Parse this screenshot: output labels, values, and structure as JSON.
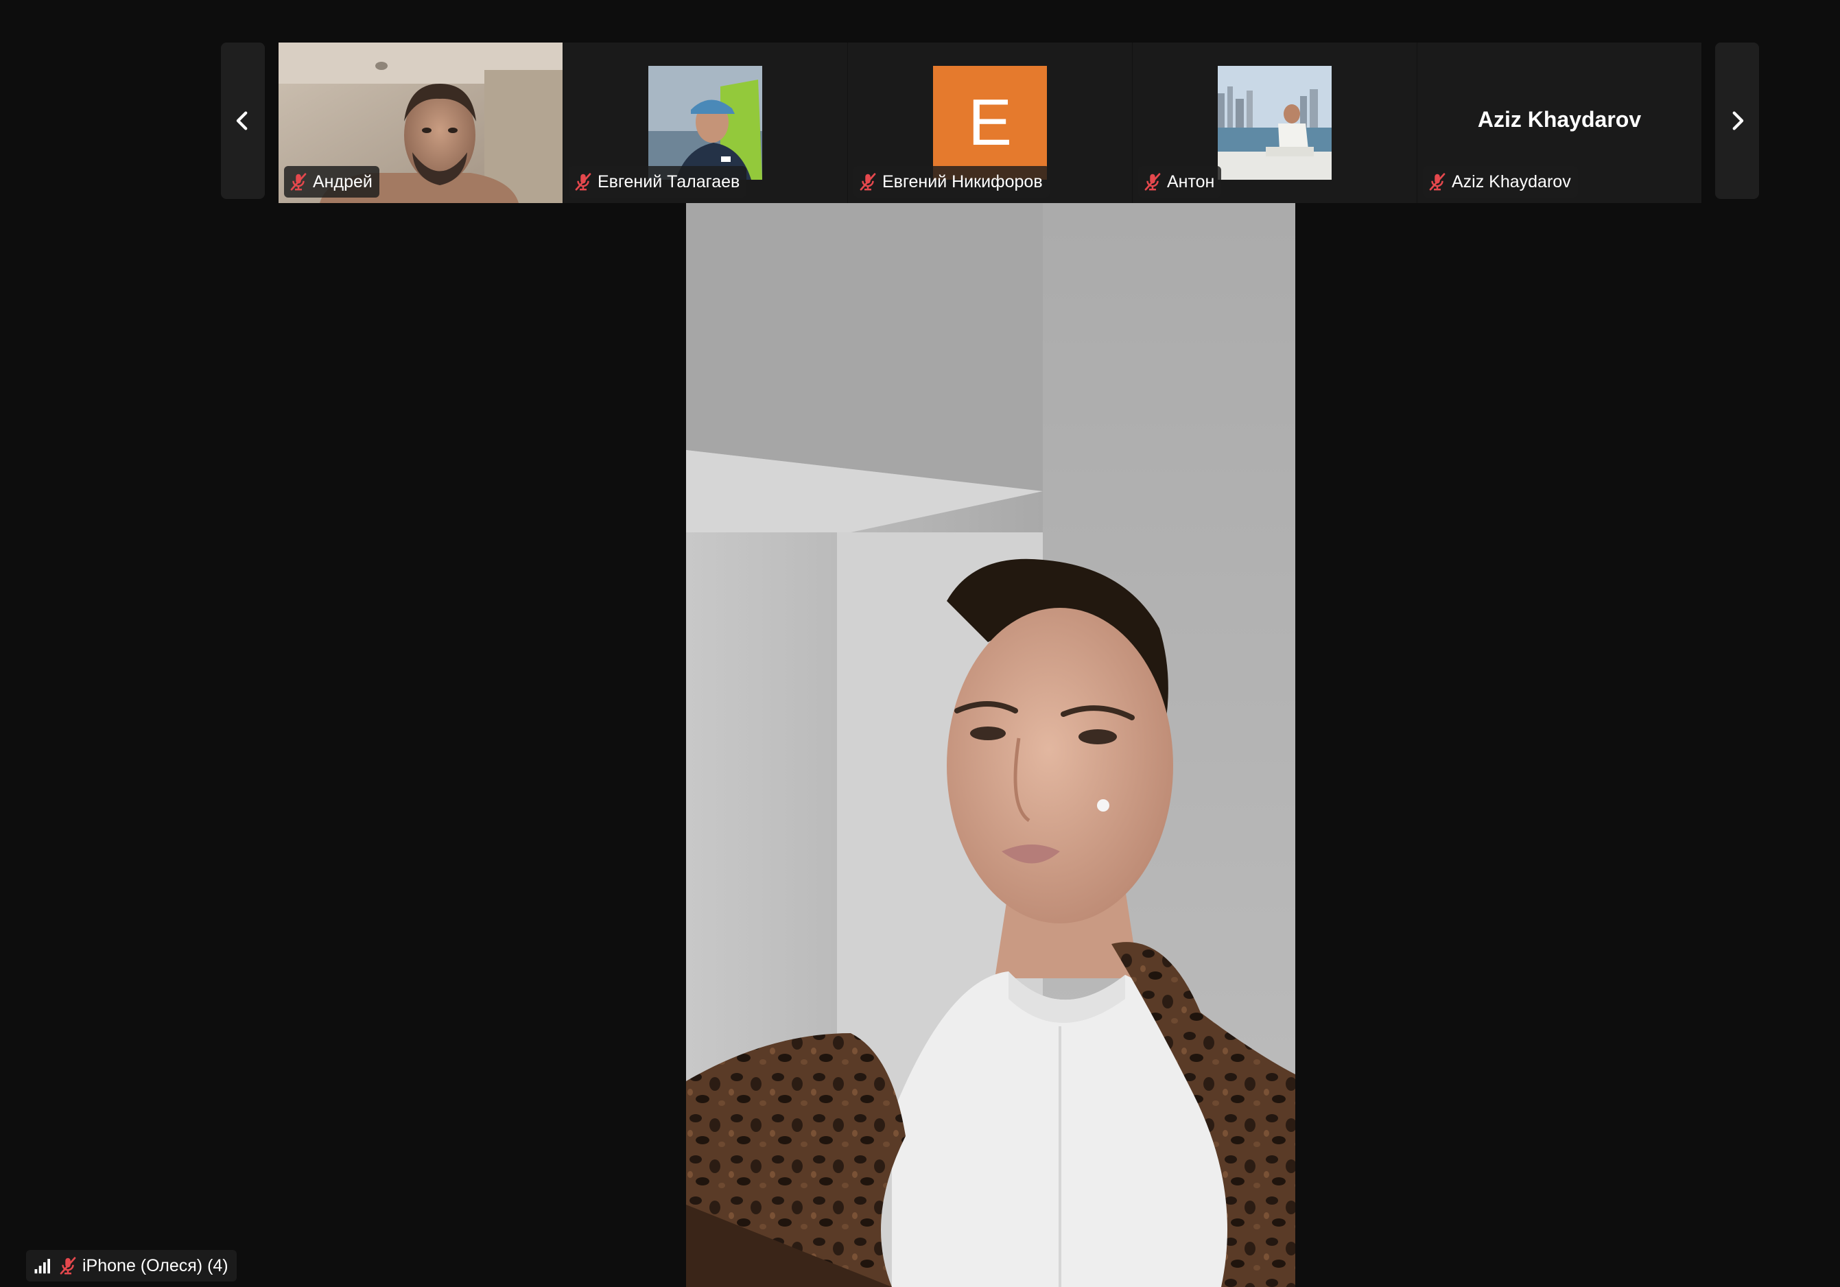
{
  "colors": {
    "background": "#0d0d0d",
    "tile_background": "#1a1a1a",
    "muted_mic": "#e5484d",
    "avatar_orange": "#e57a2d"
  },
  "filmstrip": {
    "prev_icon": "chevron-left-icon",
    "next_icon": "chevron-right-icon",
    "participants": [
      {
        "name": "Андрей",
        "muted": true,
        "video": "live-camera"
      },
      {
        "name": "Евгений Талагаев",
        "muted": true,
        "video": "profile-photo"
      },
      {
        "name": "Евгений Никифоров",
        "muted": true,
        "avatar_letter": "E"
      },
      {
        "name": "Антон",
        "muted": true,
        "video": "profile-photo"
      },
      {
        "name": "Aziz Khaydarov",
        "display_name": "Aziz Khaydarov",
        "muted": true
      }
    ]
  },
  "active_speaker": {
    "label": "iPhone (Олеся) (4)",
    "muted": true,
    "signal_icon": "signal-bars-icon"
  }
}
